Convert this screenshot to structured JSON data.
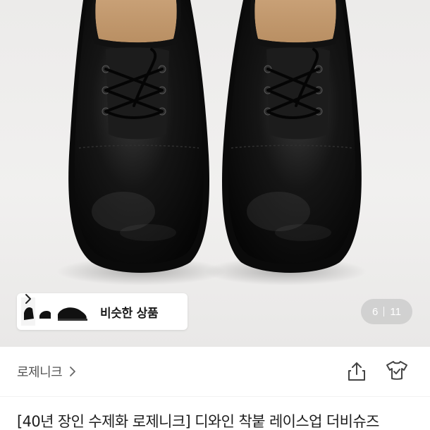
{
  "similar": {
    "label": "비슷한 상품"
  },
  "gallery": {
    "current": "6",
    "total": "11"
  },
  "shop": {
    "name": "로제니크"
  },
  "product": {
    "title": "[40년 장인 수제화 로제니크] 디와인 착붙 레이스업 더비슈즈"
  },
  "icons": {
    "similar_chevron": "chevron-right-icon",
    "shop_chevron": "chevron-right-icon",
    "share": "share-icon",
    "dress": "dress-icon"
  },
  "colors": {
    "background": "#ffffff",
    "hero": "#eeedec",
    "counter_bg": "#c8c8c8",
    "text": "#1e1e1e",
    "muted": "#555555"
  }
}
